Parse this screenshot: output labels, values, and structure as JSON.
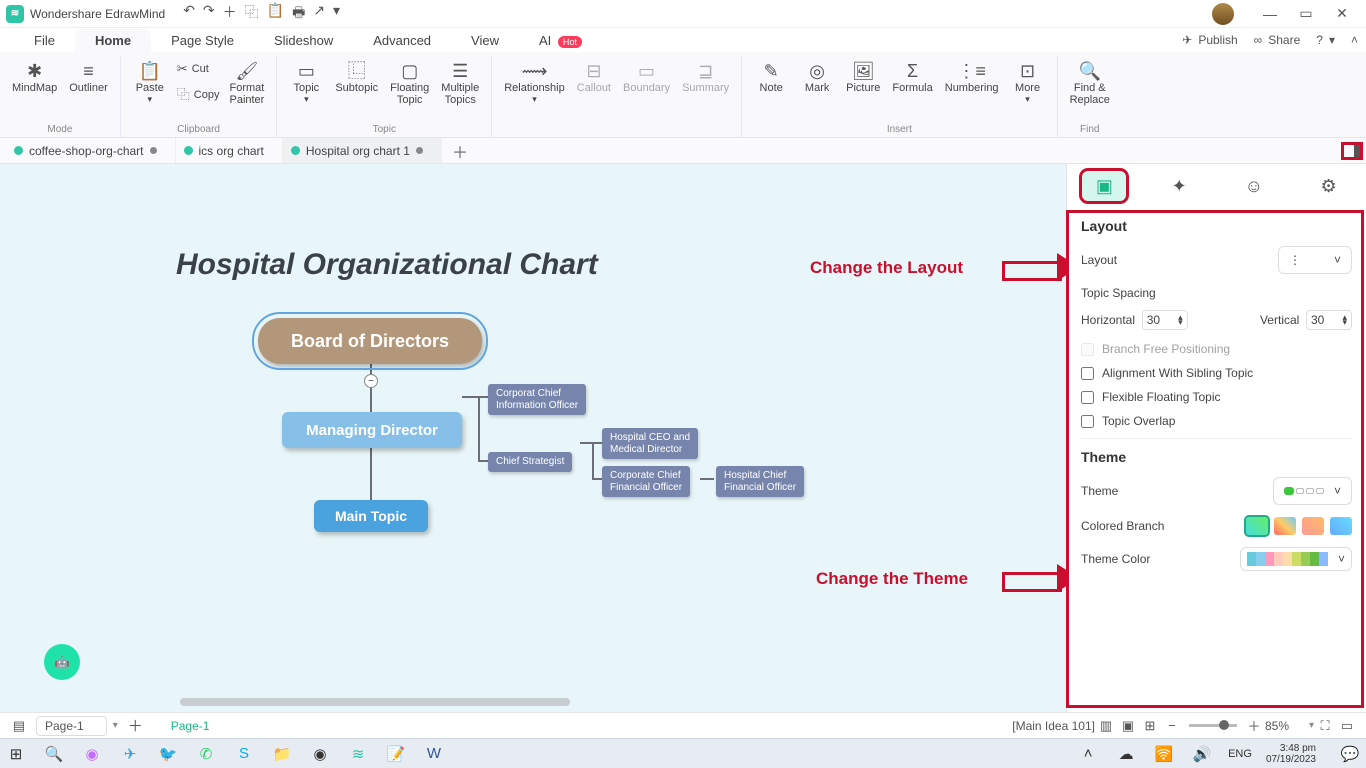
{
  "titlebar": {
    "app_name": "Wondershare EdrawMind"
  },
  "qat": {
    "undo": "↶",
    "redo": "↷",
    "plus": "＋",
    "copy": "⿻",
    "paste": "📋",
    "print": "🖶",
    "share": "↗",
    "drop": "▾"
  },
  "win": {
    "min": "—",
    "max": "▭",
    "close": "✕"
  },
  "menu": {
    "file": "File",
    "home": "Home",
    "page": "Page Style",
    "slideshow": "Slideshow",
    "advanced": "Advanced",
    "view": "View",
    "ai": "AI",
    "ai_badge": "Hot",
    "publish": "Publish",
    "share": "Share"
  },
  "ribbon": {
    "mindmap": "MindMap",
    "outliner": "Outliner",
    "mode": "Mode",
    "paste": "Paste",
    "cut": "Cut",
    "copy": "Copy",
    "fpainter_l1": "Format",
    "fpainter_l2": "Painter",
    "clipboard": "Clipboard",
    "topic": "Topic",
    "subtopic": "Subtopic",
    "ftopic_l1": "Floating",
    "ftopic_l2": "Topic",
    "mtopics_l1": "Multiple",
    "mtopics_l2": "Topics",
    "topic_grp": "Topic",
    "relationship": "Relationship",
    "callout": "Callout",
    "boundary": "Boundary",
    "summary": "Summary",
    "note": "Note",
    "mark": "Mark",
    "picture": "Picture",
    "formula": "Formula",
    "numbering": "Numbering",
    "more": "More",
    "insert": "Insert",
    "find_l1": "Find &",
    "find_l2": "Replace",
    "find_grp": "Find"
  },
  "tabs": [
    {
      "name": "coffee-shop-org-chart",
      "dirty": true
    },
    {
      "name": "ics org chart",
      "dirty": false
    },
    {
      "name": "Hospital org chart 1",
      "dirty": true
    }
  ],
  "canvas": {
    "title": "Hospital Organizational Chart",
    "root": "Board of Directors",
    "md": "Managing Director",
    "mt": "Main Topic",
    "s1a": "Corporat Chief",
    "s1b": "Information Officer",
    "s2": "Chief Strategist",
    "s3a": "Hospital CEO and",
    "s3b": "Medical Director",
    "s4a": "Corporate Chief",
    "s4b": "Financial Officer",
    "s5a": "Hospital Chief",
    "s5b": "Financial Officer",
    "annot_layout": "Change the Layout",
    "annot_theme": "Change the Theme",
    "collapse": "−"
  },
  "side": {
    "layout_h": "Layout",
    "layout_k": "Layout",
    "layout_icon": "⋮",
    "spacing_h": "Topic Spacing",
    "horiz_k": "Horizontal",
    "horiz_v": "30",
    "vert_k": "Vertical",
    "vert_v": "30",
    "cb1": "Branch Free Positioning",
    "cb2": "Alignment With Sibling Topic",
    "cb3": "Flexible Floating Topic",
    "cb4": "Topic Overlap",
    "theme_h": "Theme",
    "theme_k": "Theme",
    "cbranch": "Colored Branch",
    "tcolor": "Theme Color"
  },
  "status": {
    "page_sel": "Page-1",
    "page_lab": "Page-1",
    "idea": "[Main Idea 101]",
    "zoom": "85%",
    "minus": "−",
    "plus": "＋"
  },
  "taskbar": {
    "time": "3:48 pm",
    "date": "07/19/2023",
    "lang": "ENG"
  }
}
